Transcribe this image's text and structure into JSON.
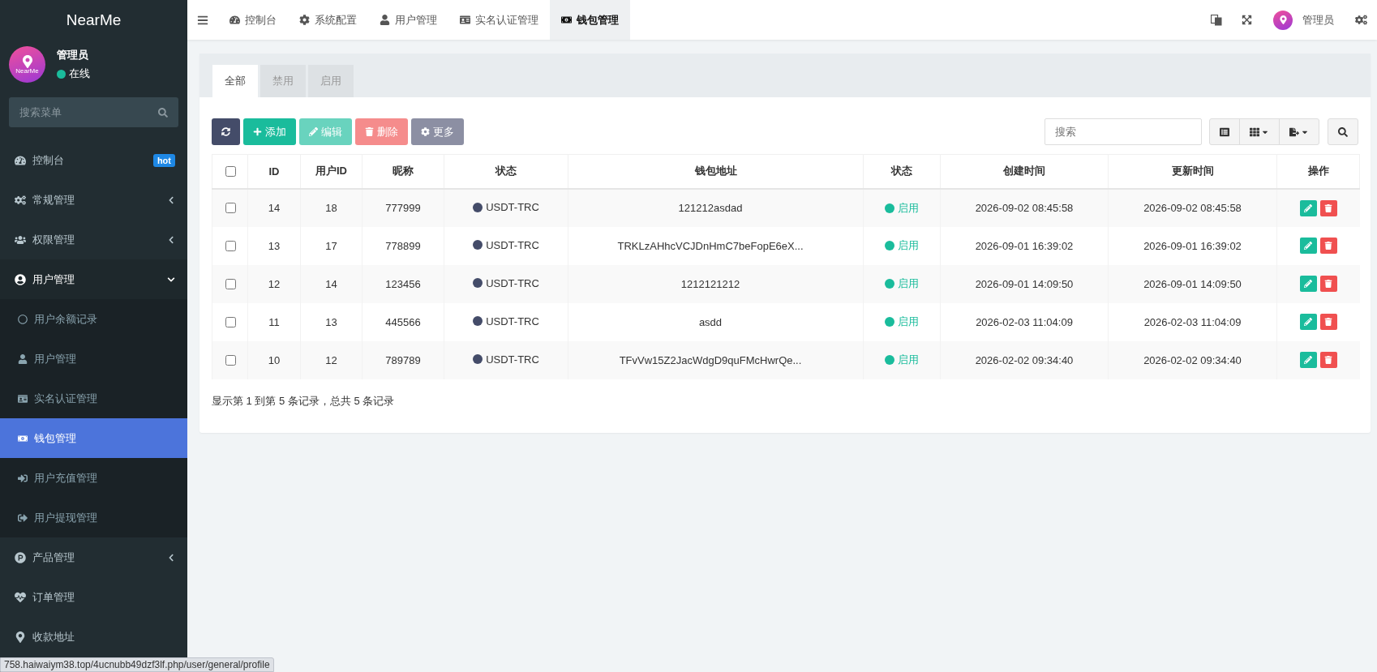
{
  "sidebar": {
    "brand": "NearMe",
    "user": {
      "avatar_label": "NearMe",
      "name": "管理员",
      "status": "在线"
    },
    "search": {
      "placeholder": "搜索菜单"
    },
    "menu": [
      {
        "label": "控制台",
        "badge": "hot",
        "selected": false
      },
      {
        "label": "常规管理",
        "expanded": false,
        "selected": false
      },
      {
        "label": "权限管理",
        "expanded": false,
        "selected": false
      },
      {
        "label": "用户管理",
        "expanded": true,
        "selected": false,
        "children": [
          {
            "label": "用户余额记录",
            "selected": false
          },
          {
            "label": "用户管理",
            "selected": false
          },
          {
            "label": "实名认证管理",
            "selected": false
          },
          {
            "label": "钱包管理",
            "selected": true
          },
          {
            "label": "用户充值管理",
            "selected": false
          },
          {
            "label": "用户提现管理",
            "selected": false
          }
        ]
      },
      {
        "label": "产品管理",
        "expanded": false,
        "selected": false
      },
      {
        "label": "订单管理",
        "selected": false
      },
      {
        "label": "收款地址",
        "selected": false
      }
    ]
  },
  "topbar": {
    "tabs": [
      {
        "label": "控制台",
        "selected": false
      },
      {
        "label": "系统配置",
        "selected": false
      },
      {
        "label": "用户管理",
        "selected": false
      },
      {
        "label": "实名认证管理",
        "selected": false
      },
      {
        "label": "钱包管理",
        "selected": true
      }
    ],
    "user": "管理员"
  },
  "panel": {
    "tabs": [
      {
        "label": "全部",
        "selected": true
      },
      {
        "label": "禁用",
        "selected": false
      },
      {
        "label": "启用",
        "selected": false
      }
    ],
    "buttons": [
      {
        "kind": "refresh",
        "disabled": false
      },
      {
        "kind": "add",
        "label": "添加",
        "disabled": false
      },
      {
        "kind": "edit",
        "label": "编辑",
        "disabled": true
      },
      {
        "kind": "delete",
        "label": "删除",
        "disabled": true
      },
      {
        "kind": "more",
        "label": "更多",
        "disabled": false
      }
    ],
    "search": {
      "placeholder": "搜索"
    },
    "table": {
      "all_checked": false,
      "columns": [
        "ID",
        "用户ID",
        "昵称",
        "状态",
        "钱包地址",
        "状态",
        "创建时间",
        "更新时间",
        "操作"
      ],
      "rows": [
        {
          "checked": false,
          "id": "14",
          "user_id": "18",
          "nickname": "777999",
          "type": "USDT-TRC",
          "address": "121212asdad",
          "status": "启用",
          "created": "2026-09-02 08:45:58",
          "updated": "2026-09-02 08:45:58"
        },
        {
          "checked": false,
          "id": "13",
          "user_id": "17",
          "nickname": "778899",
          "type": "USDT-TRC",
          "address": "TRKLzAHhcVCJDnHmC7beFopE6eX...",
          "status": "启用",
          "created": "2026-09-01 16:39:02",
          "updated": "2026-09-01 16:39:02"
        },
        {
          "checked": false,
          "id": "12",
          "user_id": "14",
          "nickname": "123456",
          "type": "USDT-TRC",
          "address": "1212121212",
          "status": "启用",
          "created": "2026-09-01 14:09:50",
          "updated": "2026-09-01 14:09:50"
        },
        {
          "checked": false,
          "id": "11",
          "user_id": "13",
          "nickname": "445566",
          "type": "USDT-TRC",
          "address": "asdd",
          "status": "启用",
          "created": "2026-02-03 11:04:09",
          "updated": "2026-02-03 11:04:09"
        },
        {
          "checked": false,
          "id": "10",
          "user_id": "12",
          "nickname": "789789",
          "type": "USDT-TRC",
          "address": "TFvVw15Z2JacWdgD9quFMcHwrQe...",
          "status": "启用",
          "created": "2026-02-02 09:34:40",
          "updated": "2026-02-02 09:34:40"
        }
      ]
    },
    "footer": "显示第 1 到第 5 条记录，总共 5 条记录"
  },
  "status_url": "758.haiwaiym38.top/4ucnubb49dzf3lf.php/user/general/profile"
}
